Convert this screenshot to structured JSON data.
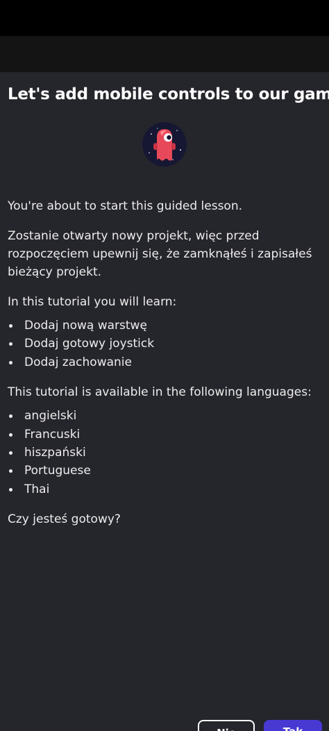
{
  "dialog": {
    "title": "Let's add mobile controls to our game",
    "avatar_icon": "red-robot-astronaut-icon",
    "intro": "You're about to start this guided lesson.",
    "warning": "Zostanie otwarty nowy projekt, więc przed rozpoczęciem upewnij się, że zamknąłeś i zapisałeś bieżący projekt.",
    "learn_heading": "In this tutorial you will learn:",
    "learn_items": [
      "Dodaj nową warstwę",
      "Dodaj gotowy joystick",
      "Dodaj zachowanie"
    ],
    "languages_heading": "This tutorial is available in the following languages:",
    "languages": [
      "angielski",
      "Francuski",
      "hiszpański",
      "Portuguese",
      "Thai"
    ],
    "question": "Czy jesteś gotowy?",
    "no_label": "Nie",
    "yes_label": "Tak"
  },
  "colors": {
    "dialog_background": "#25252c",
    "primary_button": "#4839d3",
    "avatar_background": "#161733",
    "avatar_character": "#e8495a"
  }
}
